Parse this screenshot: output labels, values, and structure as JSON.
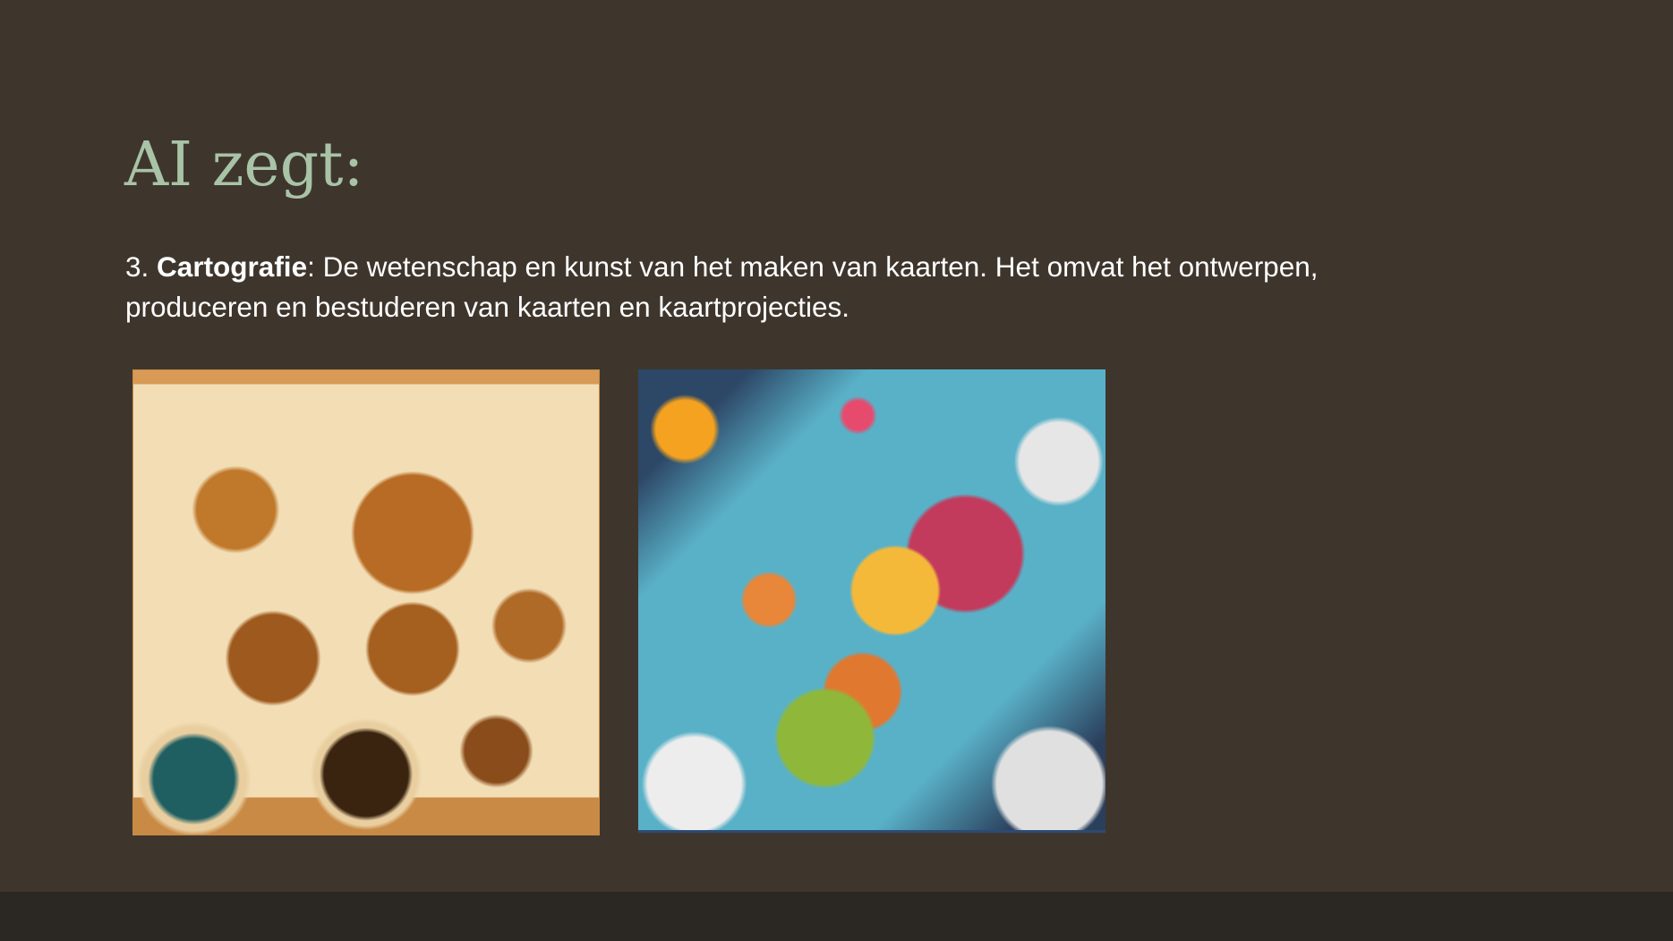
{
  "slide": {
    "title": "AI zegt:",
    "paragraph": {
      "number": "3.",
      "term": "Cartografie",
      "definition": ": De wetenschap en kunst van het maken van kaarten. Het omvat het ontwerpen, produceren en bestuderen van kaarten en kaartprojecties."
    }
  },
  "colors": {
    "background": "#3e362d",
    "footer": "#2b2722",
    "title": "#a9c3a7",
    "text": "#ffffff"
  }
}
